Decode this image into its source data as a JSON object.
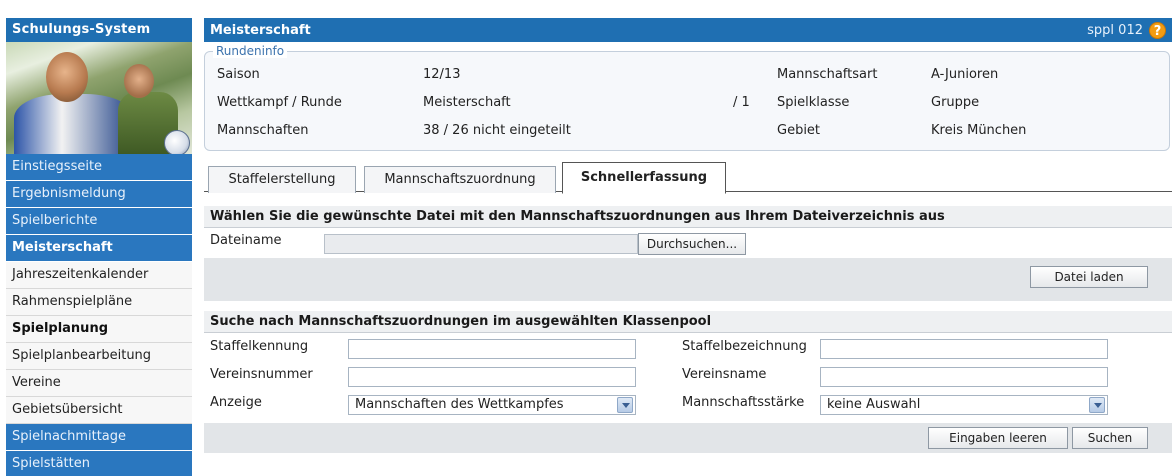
{
  "sidebar": {
    "title": "Schulungs-System",
    "items": [
      {
        "label": "Einstiegsseite"
      },
      {
        "label": "Ergebnismeldung"
      },
      {
        "label": "Spielberichte"
      },
      {
        "label": "Meisterschaft"
      },
      {
        "label": "Jahreszeitenkalender"
      },
      {
        "label": "Rahmenspielpläne"
      },
      {
        "label": "Spielplanung"
      },
      {
        "label": "Spielplanbearbeitung"
      },
      {
        "label": "Vereine"
      },
      {
        "label": "Gebietsübersicht"
      },
      {
        "label": "Spielnachmittage"
      },
      {
        "label": "Spielstätten"
      }
    ]
  },
  "header": {
    "title": "Meisterschaft",
    "code": "sppl 012",
    "help": "?"
  },
  "rundeninfo": {
    "legend": "Rundeninfo",
    "saison_label": "Saison",
    "saison_value": "12/13",
    "wettkampf_label": "Wettkampf / Runde",
    "wettkampf_value": "Meisterschaft",
    "runde_value": "/ 1",
    "mannschaften_label": "Mannschaften",
    "mannschaften_value": "38 / 26  nicht eingeteilt",
    "mannschaftsart_label": "Mannschaftsart",
    "mannschaftsart_value": "A-Junioren",
    "spielklasse_label": "Spielklasse",
    "spielklasse_value": "Gruppe",
    "gebiet_label": "Gebiet",
    "gebiet_value": "Kreis München"
  },
  "tabs": [
    {
      "label": "Staffelerstellung"
    },
    {
      "label": "Mannschaftszuordnung"
    },
    {
      "label": "Schnellerfassung"
    }
  ],
  "upload": {
    "title": "Wählen Sie die gewünschte Datei mit den Mannschaftszuordnungen aus Ihrem Dateiverzeichnis aus",
    "file_label": "Dateiname",
    "file_value": "",
    "browse_label": "Durchsuchen...",
    "load_label": "Datei laden"
  },
  "search": {
    "title": "Suche nach Mannschaftszuordnungen im ausgewählten Klassenpool",
    "staffelkennung_label": "Staffelkennung",
    "staffelkennung_value": "",
    "staffelbezeichnung_label": "Staffelbezeichnung",
    "staffelbezeichnung_value": "",
    "vereinsnummer_label": "Vereinsnummer",
    "vereinsnummer_value": "",
    "vereinsname_label": "Vereinsname",
    "vereinsname_value": "",
    "anzeige_label": "Anzeige",
    "anzeige_value": "Mannschaften des Wettkampfes",
    "staerke_label": "Mannschaftsstärke",
    "staerke_value": "keine Auswahl",
    "clear_label": "Eingaben leeren",
    "search_label": "Suchen"
  }
}
